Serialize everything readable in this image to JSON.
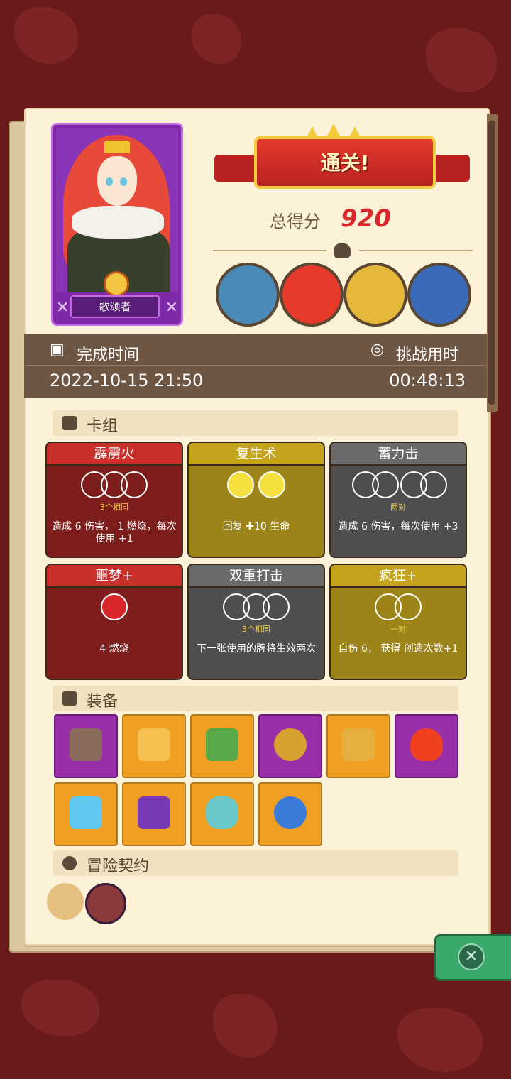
{
  "hero": {
    "name": "歌颂者"
  },
  "banner": {
    "title": "通关!"
  },
  "score": {
    "label": "总得分",
    "value": "920"
  },
  "time": {
    "finish_label": "完成时间",
    "finish_value": "2022-10-15 21:50",
    "duration_label": "挑战用时",
    "duration_value": "00:48:13"
  },
  "sections": {
    "deck": "卡组",
    "equipment": "装备",
    "contract": "冒险契约"
  },
  "cards": [
    {
      "title": "霹雳火",
      "sub": "3个相同",
      "desc": "造成 6 伤害， 1 燃烧，每次使用 +1"
    },
    {
      "title": "复生术",
      "sub": "",
      "desc": "回复 ✚10 生命"
    },
    {
      "title": "蓄力击",
      "sub": "两对",
      "desc": "造成 6 伤害，每次使用 +3"
    },
    {
      "title": "噩梦+",
      "sub": "",
      "desc": "4 燃烧"
    },
    {
      "title": "双重打击",
      "sub": "3个相同",
      "desc": "下一张使用的牌将生效两次"
    },
    {
      "title": "疯狂+",
      "sub": "一对",
      "desc": "自伤 6， 获得 创造次数+1"
    }
  ],
  "colors": {
    "accent_red": "#d8262a",
    "panel": "#fbf2d8",
    "close_green": "#3aa86a"
  }
}
